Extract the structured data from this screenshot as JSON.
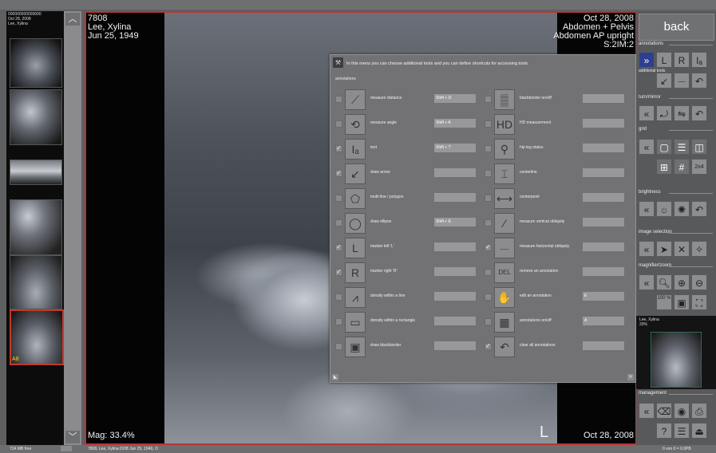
{
  "patient": {
    "id": "7808",
    "name": "Lee, Xylina",
    "dob": "Jun 25, 1949",
    "study_date": "Oct 28, 2008",
    "study": "Abdomen + Pelvis",
    "series": "Abdomen AP upright",
    "slice": "S:2IM:2",
    "magnification": "Mag: 33.4%",
    "marker": "L",
    "footer_date": "Oct 28, 2008"
  },
  "thumbs_header": {
    "line1": "000000000000000",
    "line2": "Oct 28, 2008",
    "line3": "Lee, Xylina"
  },
  "thumb_marker": "A8",
  "dialog": {
    "message": "In this menu you can choose additional tools and you can define shortcuts for accessing tools",
    "section": "annotations",
    "left_tools": [
      {
        "name": "measure distance",
        "shortcut": "Shift + D",
        "checked": false,
        "icon": "ruler-icon",
        "glyph": "⟋"
      },
      {
        "name": "measure angle",
        "shortcut": "Shift + A",
        "checked": false,
        "icon": "angle-icon",
        "glyph": "⟲"
      },
      {
        "name": "text",
        "shortcut": "Shift + T",
        "checked": true,
        "icon": "text-icon",
        "glyph": "Iₐ"
      },
      {
        "name": "draw arrow",
        "shortcut": "",
        "checked": true,
        "icon": "arrow-icon",
        "glyph": "↙"
      },
      {
        "name": "multi line / polygon",
        "shortcut": "",
        "checked": false,
        "icon": "polygon-icon",
        "glyph": "⬠"
      },
      {
        "name": "draw ellipse",
        "shortcut": "Shift + E",
        "checked": false,
        "icon": "ellipse-icon",
        "glyph": "◯"
      },
      {
        "name": "marker left 'L'",
        "shortcut": "",
        "checked": true,
        "icon": "marker-left-icon",
        "glyph": "L"
      },
      {
        "name": "marker right 'R'",
        "shortcut": "",
        "checked": true,
        "icon": "marker-right-icon",
        "glyph": "R"
      },
      {
        "name": "density within a line",
        "shortcut": "",
        "checked": false,
        "icon": "density-line-icon",
        "glyph": "⩘"
      },
      {
        "name": "density within a rectangle",
        "shortcut": "",
        "checked": false,
        "icon": "density-rect-icon",
        "glyph": "▭"
      },
      {
        "name": "draw blackborder",
        "shortcut": "",
        "checked": false,
        "icon": "blackborder-icon",
        "glyph": "▣"
      }
    ],
    "right_tools": [
      {
        "name": "blackborder on/off",
        "shortcut": "",
        "checked": false,
        "icon": "blackborder-toggle-icon",
        "glyph": "▒"
      },
      {
        "name": "HD measurement",
        "shortcut": "",
        "checked": false,
        "icon": "hd-measurement-icon",
        "glyph": "HD"
      },
      {
        "name": "hip leg status",
        "shortcut": "",
        "checked": false,
        "icon": "hip-leg-icon",
        "glyph": "⚲"
      },
      {
        "name": "centerline",
        "shortcut": "",
        "checked": false,
        "icon": "centerline-icon",
        "glyph": "⌶"
      },
      {
        "name": "centerpoint",
        "shortcut": "",
        "checked": false,
        "icon": "centerpoint-icon",
        "glyph": "⟷"
      },
      {
        "name": "measure vertical obliquity",
        "shortcut": "",
        "checked": false,
        "icon": "vertical-obliquity-icon",
        "glyph": "∕"
      },
      {
        "name": "measure horizontal obliquity",
        "shortcut": "",
        "checked": true,
        "icon": "horizontal-obliquity-icon",
        "glyph": "⏤"
      },
      {
        "name": "remove an annotation",
        "shortcut": "",
        "checked": false,
        "icon": "remove-annotation-icon",
        "glyph": "DEL"
      },
      {
        "name": "edit an annotation",
        "shortcut": "E",
        "checked": false,
        "icon": "hand-icon",
        "glyph": "✋"
      },
      {
        "name": "annotations on/off",
        "shortcut": "A",
        "checked": false,
        "icon": "annotations-toggle-icon",
        "glyph": "▦"
      },
      {
        "name": "clear all annotations",
        "shortcut": "",
        "checked": true,
        "icon": "undo-icon",
        "glyph": "↶"
      }
    ]
  },
  "panel": {
    "back": "back",
    "sections": {
      "annotations": "annotations",
      "additional_tools": "additional tools",
      "turn_mirror": "turn/mirror",
      "grid": "grid",
      "brightness": "brightness",
      "image_selection": "image selection",
      "magnifier_zoom": "magnifier/zoom",
      "management": "management"
    },
    "zoom_label": "100 %",
    "grid_label": "2x4",
    "mini_name": "Lee, Xylina",
    "mini_size": "33%"
  },
  "status": {
    "left": "724 MB free",
    "info": "7808, Lee, Xylina DOB Jun 25, 1949, O",
    "right": "0 von 0 = 0.0PB"
  }
}
